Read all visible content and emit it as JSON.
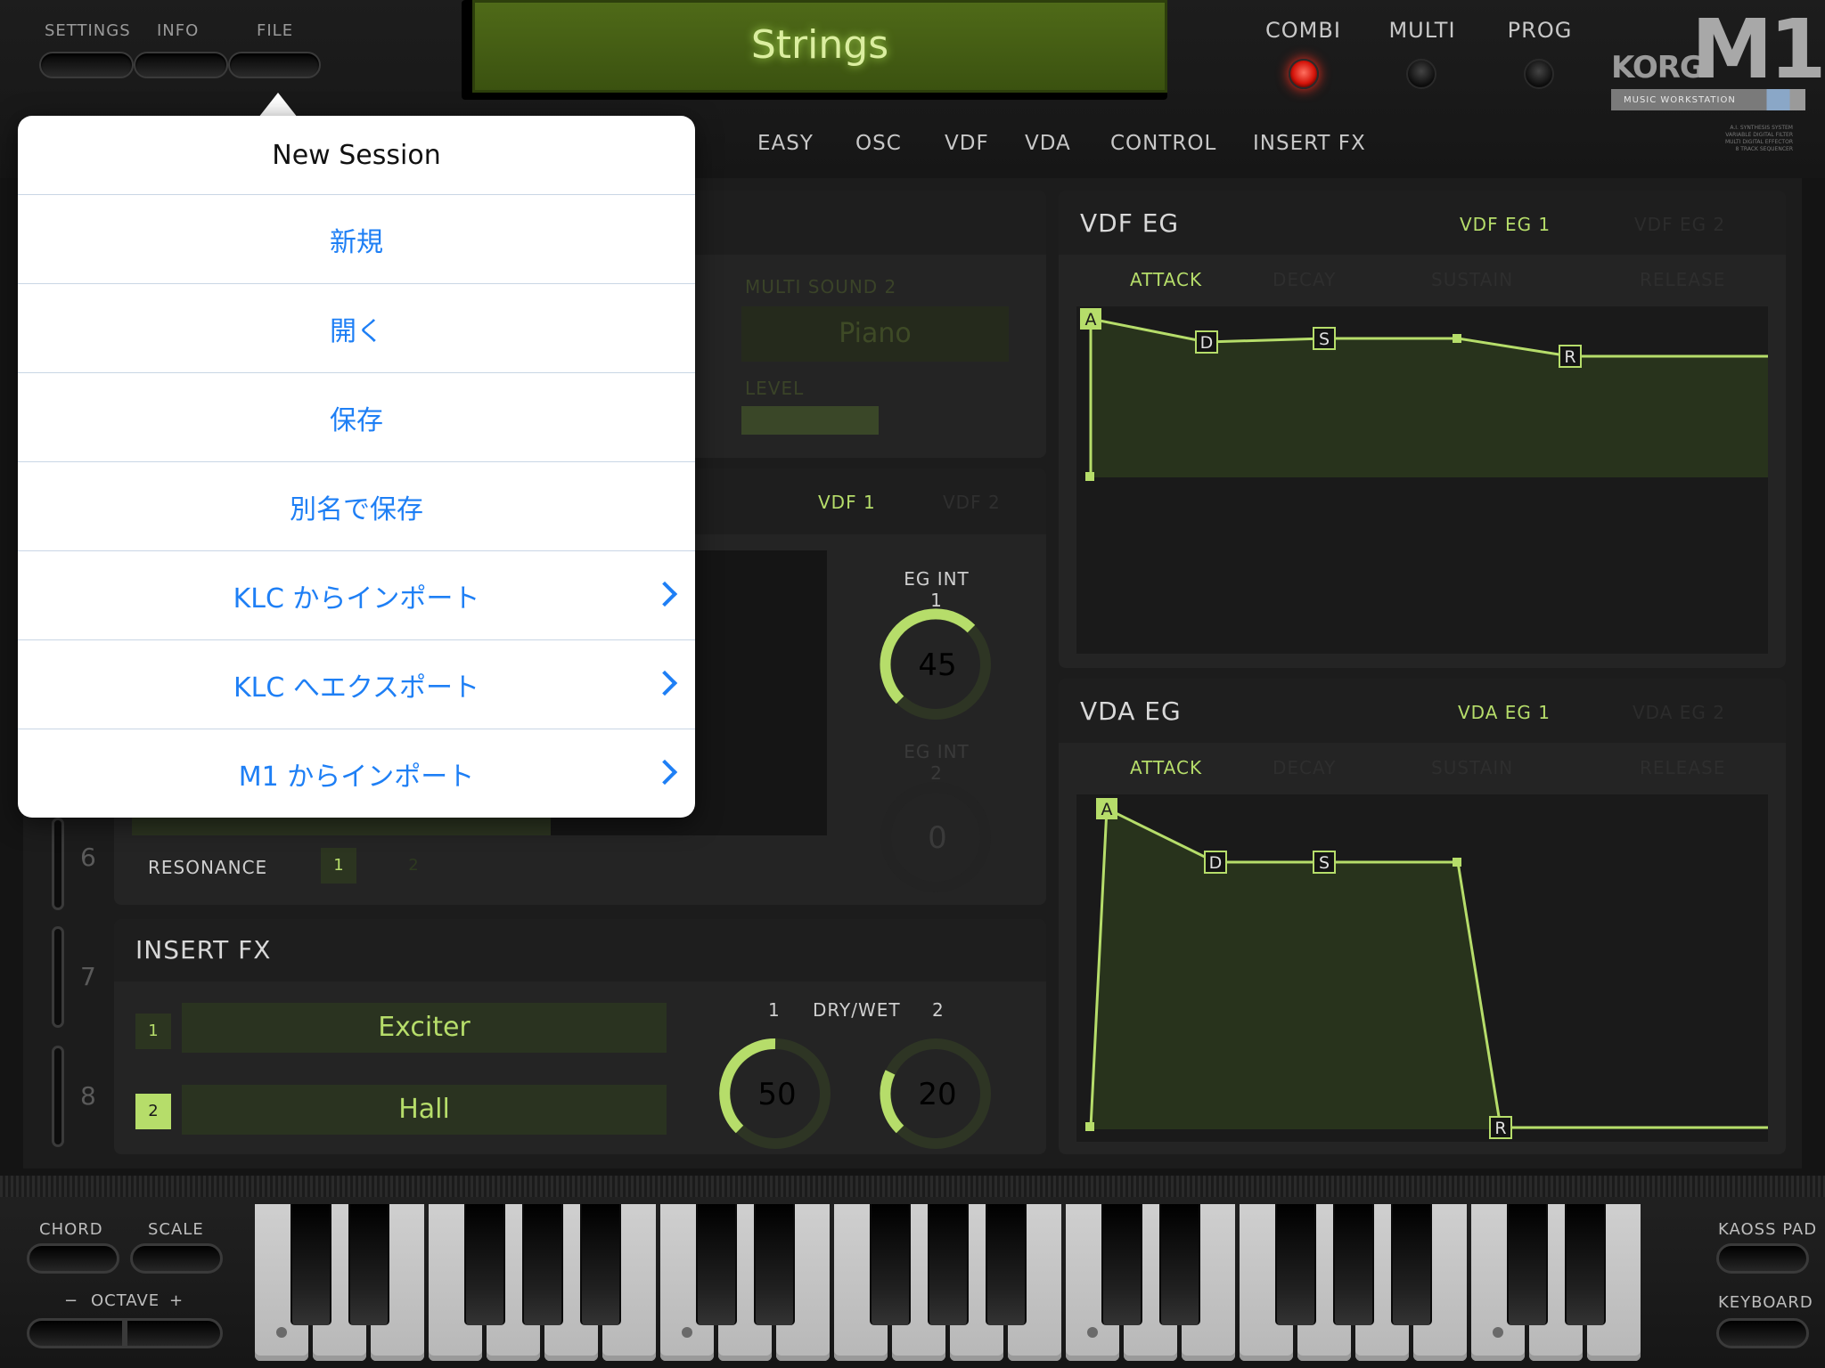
{
  "header": {
    "settings": "SETTINGS",
    "info": "INFO",
    "file": "FILE",
    "patch_name": "Strings",
    "modes": [
      {
        "label": "COMBI",
        "active": true
      },
      {
        "label": "MULTI",
        "active": false
      },
      {
        "label": "PROG",
        "active": false
      }
    ],
    "brand": "KORG",
    "model": "M1",
    "subtitle": "MUSIC WORKSTATION",
    "spec_lines": [
      "A.I. SYNTHESIS SYSTEM",
      "VARIABLE DIGITAL FILTER",
      "MULTI DIGITAL EFFECTOR",
      "8 TRACK SEQUENCER"
    ]
  },
  "tabs": [
    "EASY",
    "OSC",
    "VDF",
    "VDA",
    "CONTROL",
    "INSERT FX"
  ],
  "active_tab": "EASY",
  "osc_panel": {
    "multisound_label": "MULTI SOUND 2",
    "multisound_value": "Piano",
    "level_label": "LEVEL"
  },
  "vdf_panel": {
    "tab1": "VDF 1",
    "tab2": "VDF 2",
    "eg_int1_label": "EG INT 1",
    "eg_int1_value": "45",
    "eg_int2_label": "EG INT 2",
    "eg_int2_value": "0",
    "resonance_label": "RESONANCE",
    "res_1": "1",
    "res_2": "2"
  },
  "track_numbers": [
    "6",
    "7",
    "8"
  ],
  "insert_fx": {
    "title": "INSERT FX",
    "slots": [
      {
        "num": "1",
        "name": "Exciter"
      },
      {
        "num": "2",
        "name": "Hall"
      }
    ],
    "drywet_label": "DRY/WET",
    "k1_label": "1",
    "k2_label": "2",
    "k1_value": "50",
    "k2_value": "20"
  },
  "vdf_eg": {
    "title": "VDF EG",
    "tab1": "VDF EG 1",
    "tab2": "VDF EG 2",
    "stages": [
      "ATTACK",
      "DECAY",
      "SUSTAIN",
      "RELEASE"
    ],
    "points": {
      "a": "A",
      "d": "D",
      "s": "S",
      "r": "R"
    }
  },
  "vda_eg": {
    "title": "VDA EG",
    "tab1": "VDA EG 1",
    "tab2": "VDA EG 2",
    "stages": [
      "ATTACK",
      "DECAY",
      "SUSTAIN",
      "RELEASE"
    ],
    "points": {
      "a": "A",
      "d": "D",
      "s": "S",
      "r": "R"
    }
  },
  "popover": {
    "title": "New Session",
    "items": [
      {
        "label": "新規",
        "submenu": false
      },
      {
        "label": "開く",
        "submenu": false
      },
      {
        "label": "保存",
        "submenu": false
      },
      {
        "label": "別名で保存",
        "submenu": false
      },
      {
        "label": "KLC からインポート",
        "submenu": true
      },
      {
        "label": "KLC へエクスポート",
        "submenu": true
      },
      {
        "label": "M1 からインポート",
        "submenu": true
      }
    ]
  },
  "keyboard_controls": {
    "chord": "CHORD",
    "scale": "SCALE",
    "octave_minus": "−",
    "octave": "OCTAVE",
    "octave_plus": "+",
    "kaoss_pad": "KAOSS PAD",
    "keyboard": "KEYBOARD"
  },
  "colors": {
    "accent": "#b6dd6a",
    "led_on": "#e0241a",
    "popover_link": "#1e7ff5"
  }
}
